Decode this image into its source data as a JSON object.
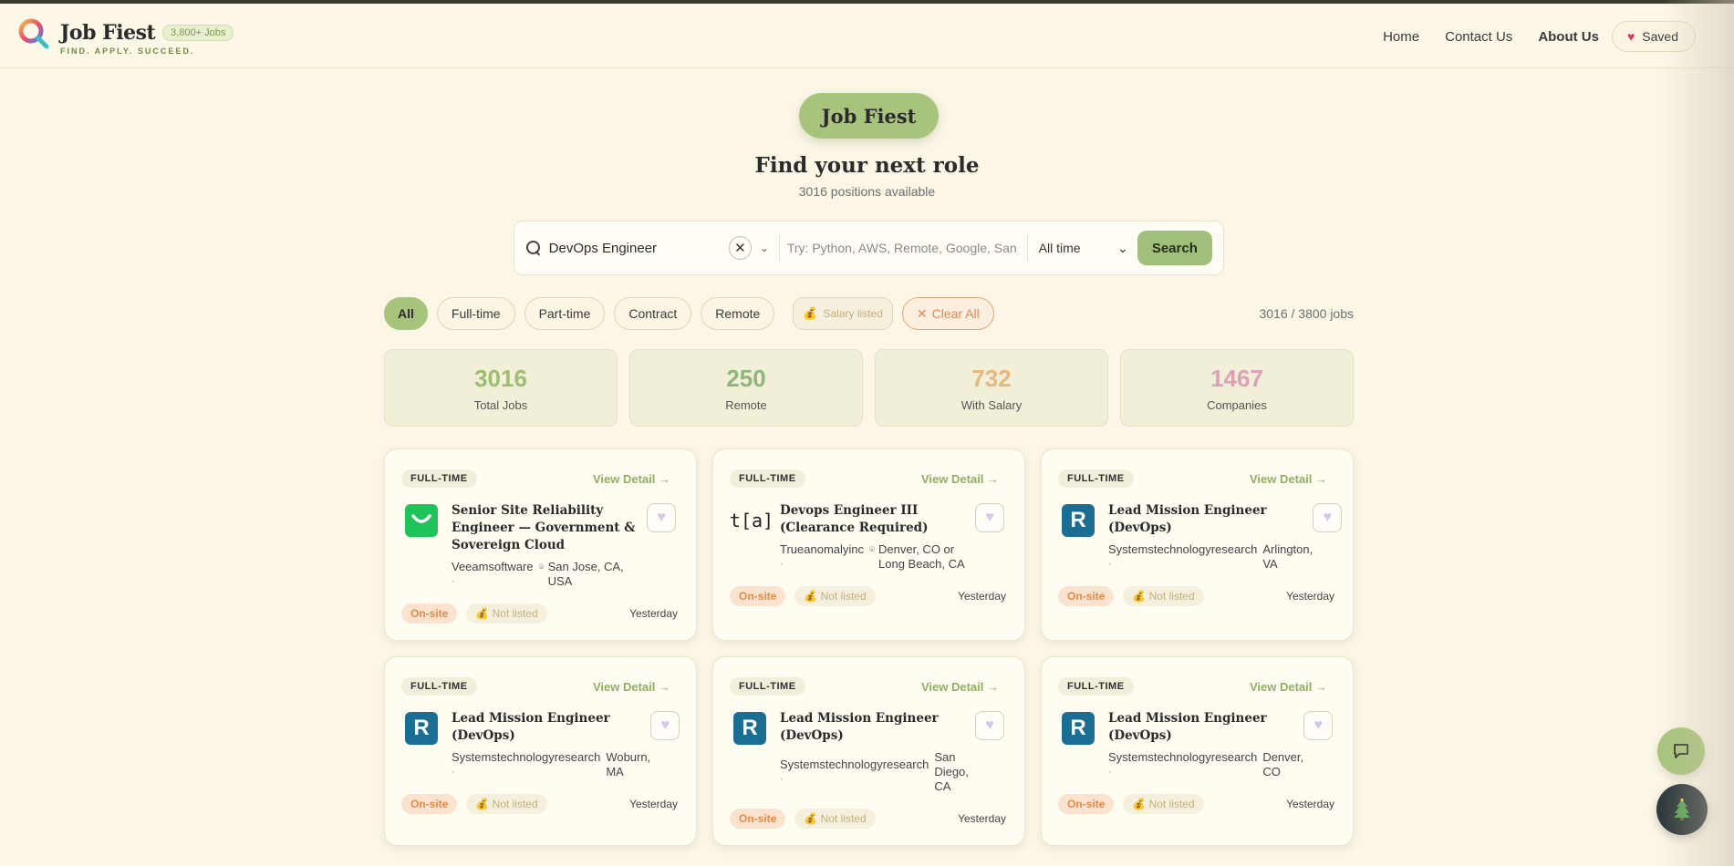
{
  "header": {
    "brand_name": "Job Fiest",
    "brand_badge": "3,800+ Jobs",
    "brand_tagline": "FIND. APPLY. SUCCEED.",
    "nav": {
      "home": "Home",
      "contact": "Contact Us",
      "about": "About Us",
      "saved": "Saved"
    }
  },
  "hero": {
    "pill": "Job Fiest",
    "title": "Find your next role",
    "subtitle": "3016 positions available"
  },
  "search": {
    "query": "DevOps Engineer",
    "keyword_placeholder": "Try: Python, AWS, Remote, Google, San Francisco",
    "time_filter": "All time",
    "button": "Search"
  },
  "filters": {
    "all": "All",
    "full_time": "Full-time",
    "part_time": "Part-time",
    "contract": "Contract",
    "remote": "Remote",
    "salary": "Salary listed",
    "clear": "Clear All",
    "count": "3016 / 3800 jobs"
  },
  "stats": [
    {
      "value": "3016",
      "label": "Total Jobs",
      "color": "#9ebd73"
    },
    {
      "value": "250",
      "label": "Remote",
      "color": "#8db77c"
    },
    {
      "value": "732",
      "label": "With Salary",
      "color": "#e6b77f"
    },
    {
      "value": "1467",
      "label": "Companies",
      "color": "#df9fb6"
    }
  ],
  "jobs": [
    {
      "type": "FULL-TIME",
      "view": "View Detail →",
      "title": "Senior Site Reliability Engineer — Government & Sovereign Cloud",
      "company": "Veeamsoftware",
      "location": "San Jose, CA, USA",
      "workplace": "On-site",
      "salary": "Not listed",
      "posted": "Yesterday"
    },
    {
      "type": "FULL-TIME",
      "view": "View Detail →",
      "title": "Devops Engineer III (Clearance Required)",
      "company": "Trueanomalyinc",
      "location": "Denver, CO or Long Beach, CA",
      "workplace": "On-site",
      "salary": "Not listed",
      "posted": "Yesterday"
    },
    {
      "type": "FULL-TIME",
      "view": "View Detail →",
      "title": "Lead Mission Engineer (DevOps)",
      "company": "Systemstechnologyresearch",
      "location": "Arlington, VA",
      "workplace": "On-site",
      "salary": "Not listed",
      "posted": "Yesterday"
    },
    {
      "type": "FULL-TIME",
      "view": "View Detail →",
      "title": "Lead Mission Engineer (DevOps)",
      "company": "Systemstechnologyresearch",
      "location": "Woburn, MA",
      "workplace": "On-site",
      "salary": "Not listed",
      "posted": "Yesterday"
    },
    {
      "type": "FULL-TIME",
      "view": "View Detail →",
      "title": "Lead Mission Engineer (DevOps)",
      "company": "Systemstechnologyresearch",
      "location": "San Diego, CA",
      "workplace": "On-site",
      "salary": "Not listed",
      "posted": "Yesterday"
    },
    {
      "type": "FULL-TIME",
      "view": "View Detail →",
      "title": "Lead Mission Engineer (DevOps)",
      "company": "Systemstechnologyresearch",
      "location": "Denver, CO",
      "workplace": "On-site",
      "salary": "Not listed",
      "posted": "Yesterday"
    }
  ],
  "logos": {
    "trueanomaly": "t[a]",
    "str": "R"
  },
  "icons": [
    "search-icon",
    "clear-icon",
    "chevron-down-icon",
    "heart-icon",
    "money-bag-icon",
    "location-pin-icon",
    "chat-icon",
    "tree-icon"
  ]
}
